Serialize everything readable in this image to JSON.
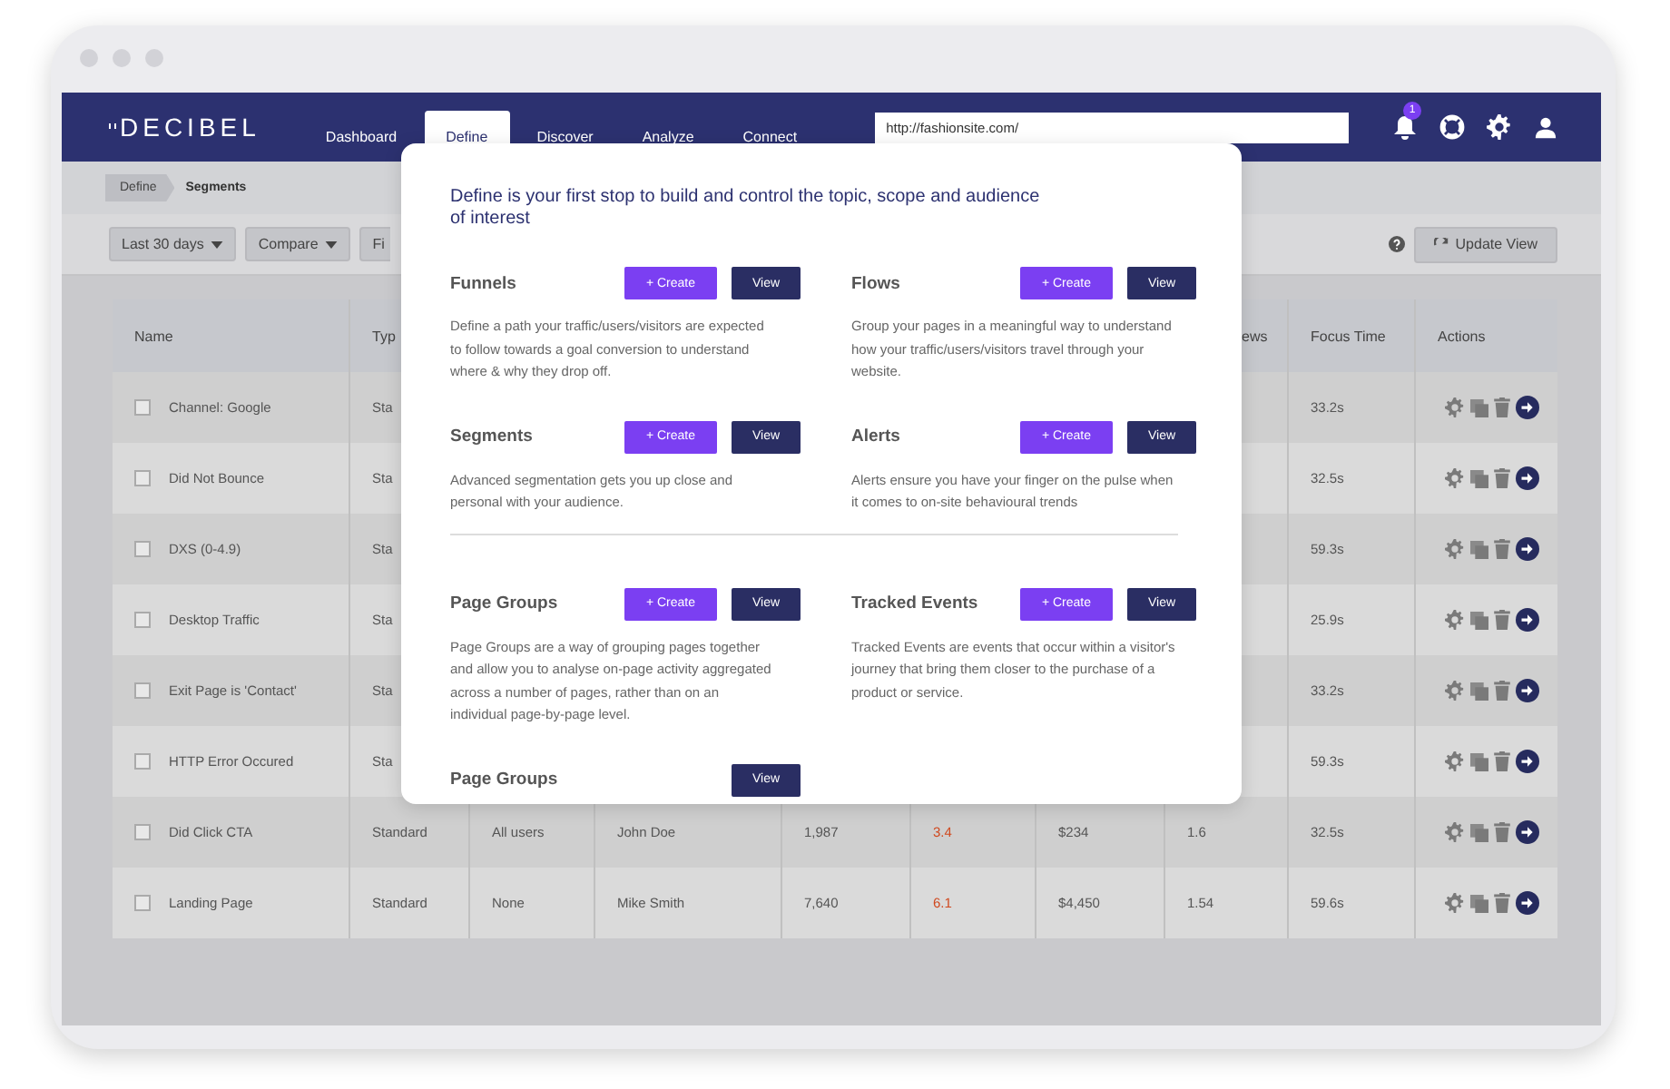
{
  "nav": {
    "logo": "DECIBEL",
    "tabs": [
      {
        "label": "Dashboard",
        "selected": false
      },
      {
        "label": "Define",
        "selected": true
      },
      {
        "label": "Discover",
        "selected": false
      },
      {
        "label": "Analyze",
        "selected": false
      },
      {
        "label": "Connect",
        "selected": false
      }
    ],
    "url": {
      "value": "http://fashionsite.com/"
    },
    "notification_count": "1"
  },
  "breadcrumb": [
    "Define",
    "Segments"
  ],
  "toolbar": {
    "filters": [
      "Last 30 days",
      "Compare",
      "Fi"
    ],
    "update_button": "Update View"
  },
  "table": {
    "columns": [
      "Name",
      "Typ",
      "ews",
      "Focus Time",
      "Actions"
    ],
    "rows": [
      {
        "name": "Channel: Google",
        "checked": false,
        "type": "Sta",
        "focus_time": "33.2s"
      },
      {
        "name": "Did Not Bounce",
        "checked": false,
        "type": "Sta",
        "focus_time": "32.5s"
      },
      {
        "name": "DXS (0-4.9)",
        "checked": false,
        "type": "Sta",
        "focus_time": "59.3s"
      },
      {
        "name": "Desktop Traffic",
        "checked": false,
        "type": "Sta",
        "focus_time": "25.9s"
      },
      {
        "name": "Exit Page is 'Contact'",
        "checked": false,
        "type": "Sta",
        "focus_time": "33.2s"
      },
      {
        "name": "HTTP Error Occured",
        "checked": false,
        "type": "Sta",
        "focus_time": "59.3s"
      },
      {
        "name": "Did Click CTA",
        "checked": false,
        "type": "Standard",
        "column_3": "All users",
        "column_4": "John Doe",
        "column_5": "1,987",
        "column_6": "3.4",
        "column_7": "$234",
        "column_8": "1.6",
        "focus_time": "32.5s"
      },
      {
        "name": "Landing Page",
        "checked": false,
        "type": "Standard",
        "column_3": "None",
        "column_4": "Mike Smith",
        "column_5": "7,640",
        "column_6": "6.1",
        "column_7": "$4,450",
        "column_8": "1.54",
        "focus_time": "59.6s"
      }
    ]
  },
  "modal": {
    "intro": "Define is your first stop to build and control the topic, scope and audience of interest",
    "blocks": [
      {
        "kind": "card",
        "title": "Funnels",
        "create": "+ Create",
        "view": "View",
        "description": "Define a path your traffic/users/visitors are expected to follow towards a goal conversion to understand where & why they drop off."
      },
      {
        "kind": "card",
        "title": "Flows",
        "create": "+ Create",
        "view": "View",
        "description": "Group your pages in a meaningful way to understand how your traffic/users/visitors travel through your website."
      },
      {
        "kind": "card",
        "title": "Segments",
        "create": "+ Create",
        "view": "View",
        "description": "Advanced segmentation gets you up close and personal with your audience."
      },
      {
        "kind": "card",
        "title": "Alerts",
        "create": "+ Create",
        "view": "View",
        "description": "Alerts ensure you have your finger on the pulse when it comes to on-site behavioural trends"
      },
      {
        "kind": "divider"
      },
      {
        "kind": "card",
        "title": "Page Groups",
        "create": "+ Create",
        "view": "View",
        "description": "Page Groups are a way of grouping pages together and allow you to analyse on-page activity aggregated across a number of pages, rather than on an individual page-by-page level."
      },
      {
        "kind": "card",
        "title": "Tracked Events",
        "create": "+ Create",
        "view": "View",
        "description": "Tracked Events are events that occur within a visitor's journey that bring them closer to the purchase of a product or service."
      },
      {
        "kind": "card",
        "title": "Page Groups",
        "view": "View"
      }
    ]
  }
}
